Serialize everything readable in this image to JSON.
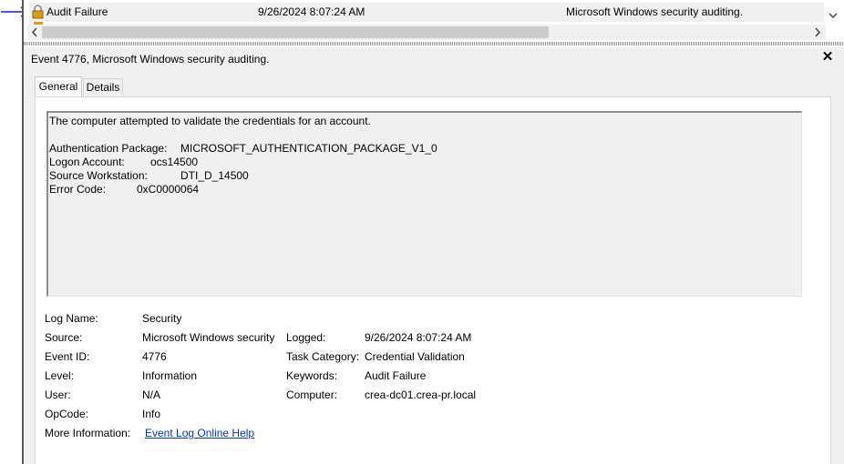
{
  "list": {
    "row": {
      "keywords": "Audit Failure",
      "date_time": "9/26/2024 8:07:24 AM",
      "source": "Microsoft Windows security auditing."
    }
  },
  "pane": {
    "title": "Event 4776, Microsoft Windows security auditing.",
    "close_label": "✕",
    "tabs": [
      "General",
      "Details"
    ]
  },
  "description": {
    "intro": "The computer attempted to validate the credentials for an account.",
    "fields": [
      {
        "label": "Authentication Package:",
        "value": "MICROSOFT_AUTHENTICATION_PACKAGE_V1_0"
      },
      {
        "label": "Logon Account:",
        "value": "ocs14500"
      },
      {
        "label": "Source Workstation:",
        "value": "DTI_D_14500"
      },
      {
        "label": "Error Code:",
        "value": "0xC0000064"
      }
    ]
  },
  "properties": {
    "log_name": {
      "label": "Log Name:",
      "value": "Security"
    },
    "source": {
      "label": "Source:",
      "value": "Microsoft Windows security"
    },
    "logged": {
      "label": "Logged:",
      "value": "9/26/2024 8:07:24 AM"
    },
    "event_id": {
      "label": "Event ID:",
      "value": "4776"
    },
    "task_category": {
      "label": "Task Category:",
      "value": "Credential Validation"
    },
    "level": {
      "label": "Level:",
      "value": "Information"
    },
    "keywords": {
      "label": "Keywords:",
      "value": "Audit Failure"
    },
    "user": {
      "label": "User:",
      "value": "N/A"
    },
    "computer": {
      "label": "Computer:",
      "value": "crea-dc01.crea-pr.local"
    },
    "opcode": {
      "label": "OpCode:",
      "value": "Info"
    },
    "more_info": {
      "label": "More Information:",
      "value": "Event Log Online Help"
    }
  },
  "colors": {
    "link": "#0033cc",
    "annotation_arrow": "#1f1fbf",
    "lock_icon": "#d4a017"
  },
  "icons": {
    "lock": "lock-icon",
    "arrow": "arrow-right-icon",
    "scroll_left": "chevron-left-icon",
    "scroll_right": "chevron-right-icon",
    "scroll_down": "chevron-down-icon",
    "close": "close-icon"
  }
}
